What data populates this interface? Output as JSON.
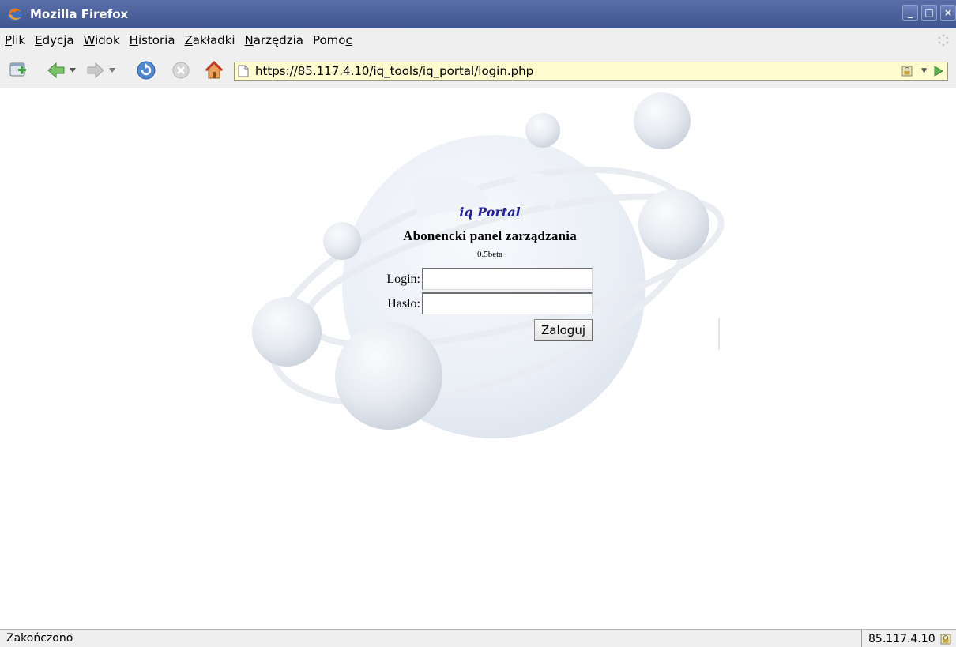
{
  "window": {
    "title": "Mozilla Firefox",
    "buttons": {
      "minimize": "_",
      "maximize": "□",
      "close": "×"
    }
  },
  "menu": [
    {
      "pre": "",
      "key": "P",
      "post": "lik"
    },
    {
      "pre": "",
      "key": "E",
      "post": "dycja"
    },
    {
      "pre": "",
      "key": "W",
      "post": "idok"
    },
    {
      "pre": "",
      "key": "H",
      "post": "istoria"
    },
    {
      "pre": "",
      "key": "Z",
      "post": "akładki"
    },
    {
      "pre": "",
      "key": "N",
      "post": "arzędzia"
    },
    {
      "pre": "Pomo",
      "key": "c",
      "post": ""
    }
  ],
  "toolbar": {
    "url": "https://85.117.4.10/iq_tools/iq_portal/login.php",
    "icons": [
      "new-tab-icon",
      "back-icon",
      "forward-icon",
      "reload-icon",
      "stop-icon",
      "home-icon"
    ]
  },
  "login": {
    "portal_title": "iq Portal",
    "panel_title": "Abonencki panel zarządzania",
    "version": "0.5beta",
    "login_label": "Login:",
    "password_label": "Hasło:",
    "login_value": "",
    "password_value": "",
    "submit_label": "Zaloguj"
  },
  "status": {
    "text": "Zakończono",
    "host": "85.117.4.10"
  },
  "colors": {
    "titlebar": "#4a5f9c",
    "chrome": "#efefef",
    "urlbar_bg": "#fffcd0",
    "portal_title": "#23239c"
  }
}
